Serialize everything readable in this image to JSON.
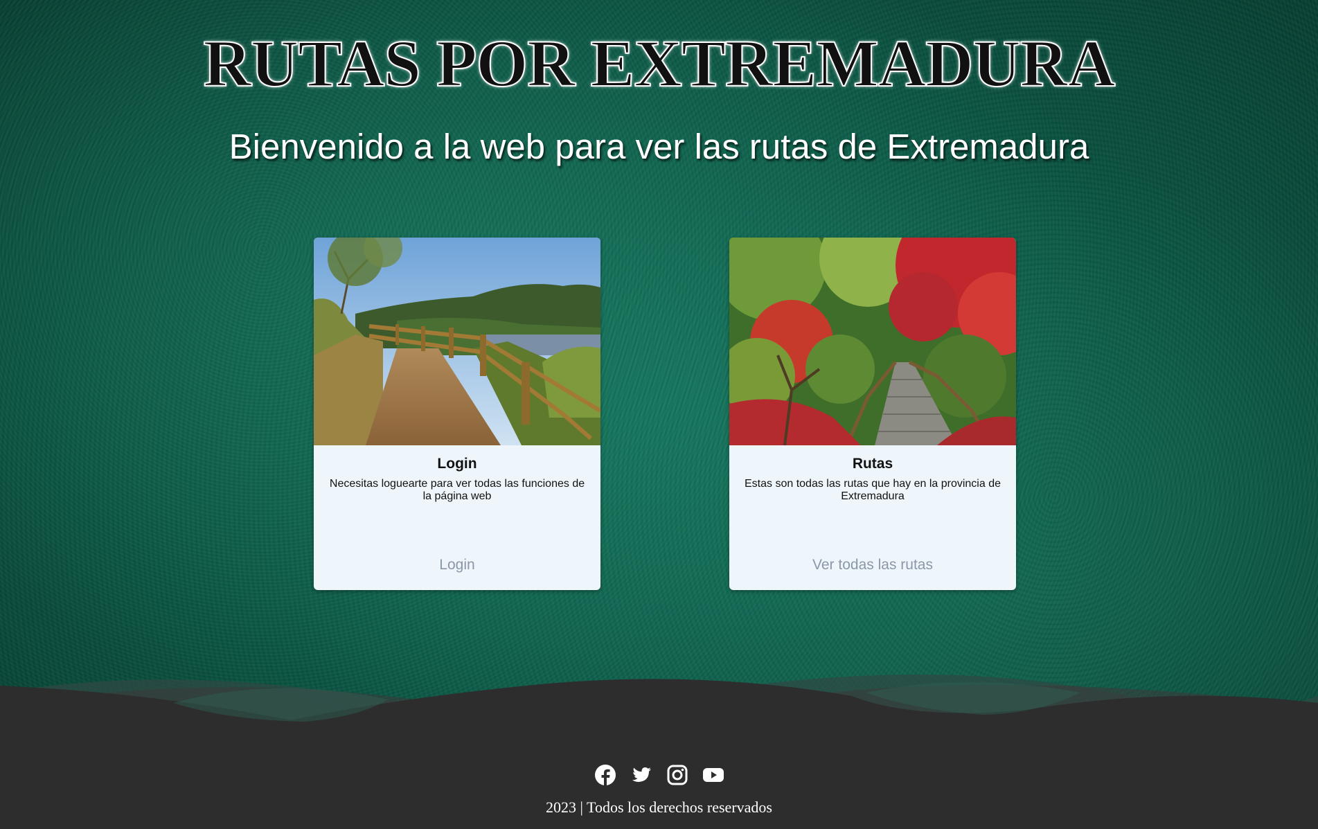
{
  "header": {
    "title": "RUTAS POR EXTREMADURA",
    "subtitle": "Bienvenido a la web para ver las rutas de Extremadura"
  },
  "cards": [
    {
      "title": "Login",
      "text": "Necesitas loguearte para ver todas las funciones de la página web",
      "link_label": "Login",
      "image": "landscape photo of a dirt path with wooden fence beside a river and hills"
    },
    {
      "title": "Rutas",
      "text": "Estas son todas las rutas que hay en la provincia de Extremadura",
      "link_label": "Ver todas las rutas",
      "image": "landscape photo of a wooden staircase path through a garden with red and green trees"
    }
  ],
  "footer": {
    "social_icons": [
      "facebook-icon",
      "twitter-icon",
      "instagram-icon",
      "youtube-icon"
    ],
    "copyright": "2023 | Todos los derechos reservados"
  },
  "colors": {
    "background": "#0b5a47",
    "card_background": "#eff6fb",
    "footer_background": "#2d2d2d",
    "link": "#8a97a8"
  }
}
